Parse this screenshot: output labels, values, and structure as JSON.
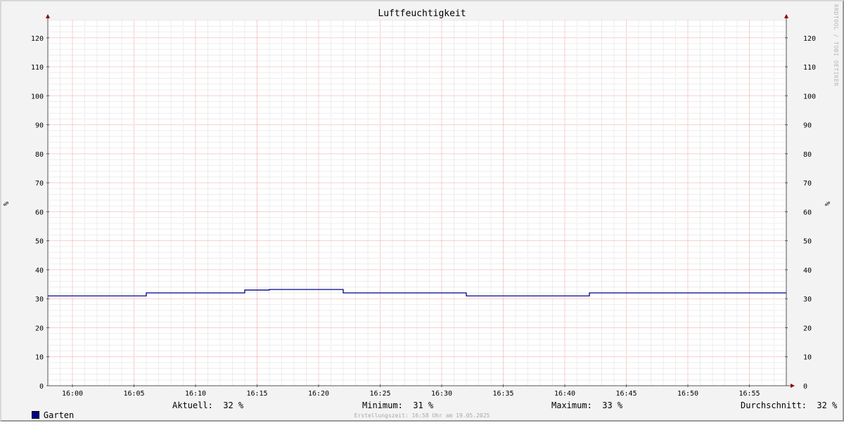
{
  "chart_data": {
    "type": "line",
    "title": "Luftfeuchtigkeit",
    "ylabel": "%",
    "ylabel_right": "%",
    "ylim": [
      0,
      126
    ],
    "yticks": [
      0,
      10,
      20,
      30,
      40,
      50,
      60,
      70,
      80,
      90,
      100,
      110,
      120
    ],
    "xlim": [
      "15:58",
      "16:58"
    ],
    "xticks": [
      "16:00",
      "16:05",
      "16:10",
      "16:15",
      "16:20",
      "16:25",
      "16:30",
      "16:35",
      "16:40",
      "16:45",
      "16:50",
      "16:55"
    ],
    "grid": true,
    "series": [
      {
        "name": "Garten",
        "color": "#00008b",
        "x": [
          "15:58",
          "16:06",
          "16:06",
          "16:14",
          "16:14",
          "16:16",
          "16:16",
          "16:22",
          "16:22",
          "16:32",
          "16:32",
          "16:42",
          "16:42",
          "16:58"
        ],
        "values": [
          31,
          31,
          32,
          32,
          33,
          33,
          33.2,
          33.2,
          32,
          32,
          31,
          31,
          32,
          32
        ]
      }
    ]
  },
  "watermark": "RRDTOOL / TOBI OETIKER",
  "legend": {
    "series_name": "Garten",
    "aktuell": "Aktuell:  32 %",
    "minimum": "Minimum:  31 %",
    "maximum": "Maximum:  33 %",
    "durchschnitt": "Durchschnitt:  32 %"
  },
  "footer": "Erstellungszeit: 16:58 Uhr am 19.05.2025"
}
